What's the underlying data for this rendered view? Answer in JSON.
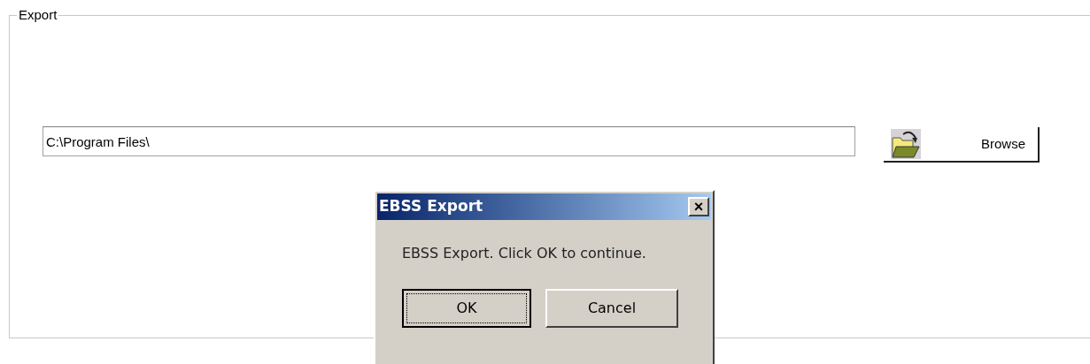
{
  "group": {
    "title": "Export"
  },
  "path_field": {
    "value": "C:\\Program Files\\"
  },
  "browse_button": {
    "label": "Browse"
  },
  "dialog": {
    "title": "EBSS Export",
    "close": "×",
    "message": "EBSS Export. Click OK to continue.",
    "buttons": [
      {
        "label": "OK",
        "focused": true
      },
      {
        "label": "Cancel",
        "focused": false
      }
    ]
  }
}
